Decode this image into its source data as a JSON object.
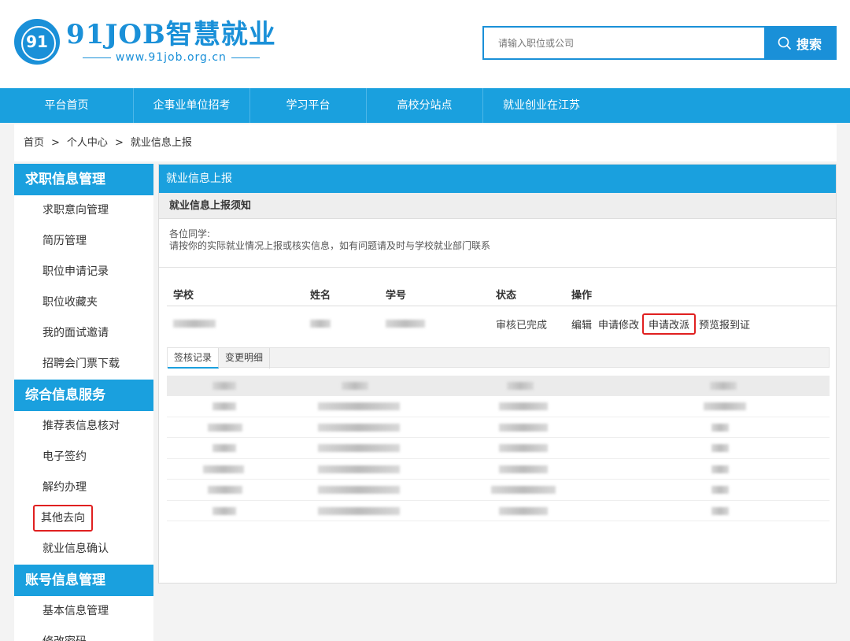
{
  "header": {
    "logo_mark": "91",
    "logo_title": "91JOB智慧就业",
    "logo_url": "www.91job.org.cn",
    "search_placeholder": "请输入职位或公司",
    "search_button": "搜索"
  },
  "nav": [
    "平台首页",
    "企事业单位招考",
    "学习平台",
    "高校分站点",
    "就业创业在江苏"
  ],
  "breadcrumb": [
    "首页",
    "个人中心",
    "就业信息上报"
  ],
  "breadcrumb_sep": ">",
  "sidebar": {
    "groups": [
      {
        "title": "求职信息管理",
        "items": [
          "求职意向管理",
          "简历管理",
          "职位申请记录",
          "职位收藏夹",
          "我的面试邀请",
          "招聘会门票下载"
        ]
      },
      {
        "title": "综合信息服务",
        "items": [
          "推荐表信息核对",
          "电子签约",
          "解约办理",
          "其他去向",
          "就业信息确认"
        ]
      },
      {
        "title": "账号信息管理",
        "items": [
          "基本信息管理",
          "修改密码"
        ]
      }
    ]
  },
  "main": {
    "title": "就业信息上报",
    "notice_title": "就业信息上报须知",
    "notice_line1": "各位同学:",
    "notice_line2": "请按你的实际就业情况上报或核实信息，如有问题请及时与学校就业部门联系",
    "columns": [
      "学校",
      "姓名",
      "学号",
      "状态",
      "操作"
    ],
    "status": "审核已完成",
    "ops": [
      "编辑",
      "申请修改",
      "申请改派",
      "预览报到证"
    ],
    "tabs": [
      "签核记录",
      "变更明细"
    ]
  },
  "colors": {
    "brand": "#1aa0de",
    "highlight": "#e02020"
  }
}
